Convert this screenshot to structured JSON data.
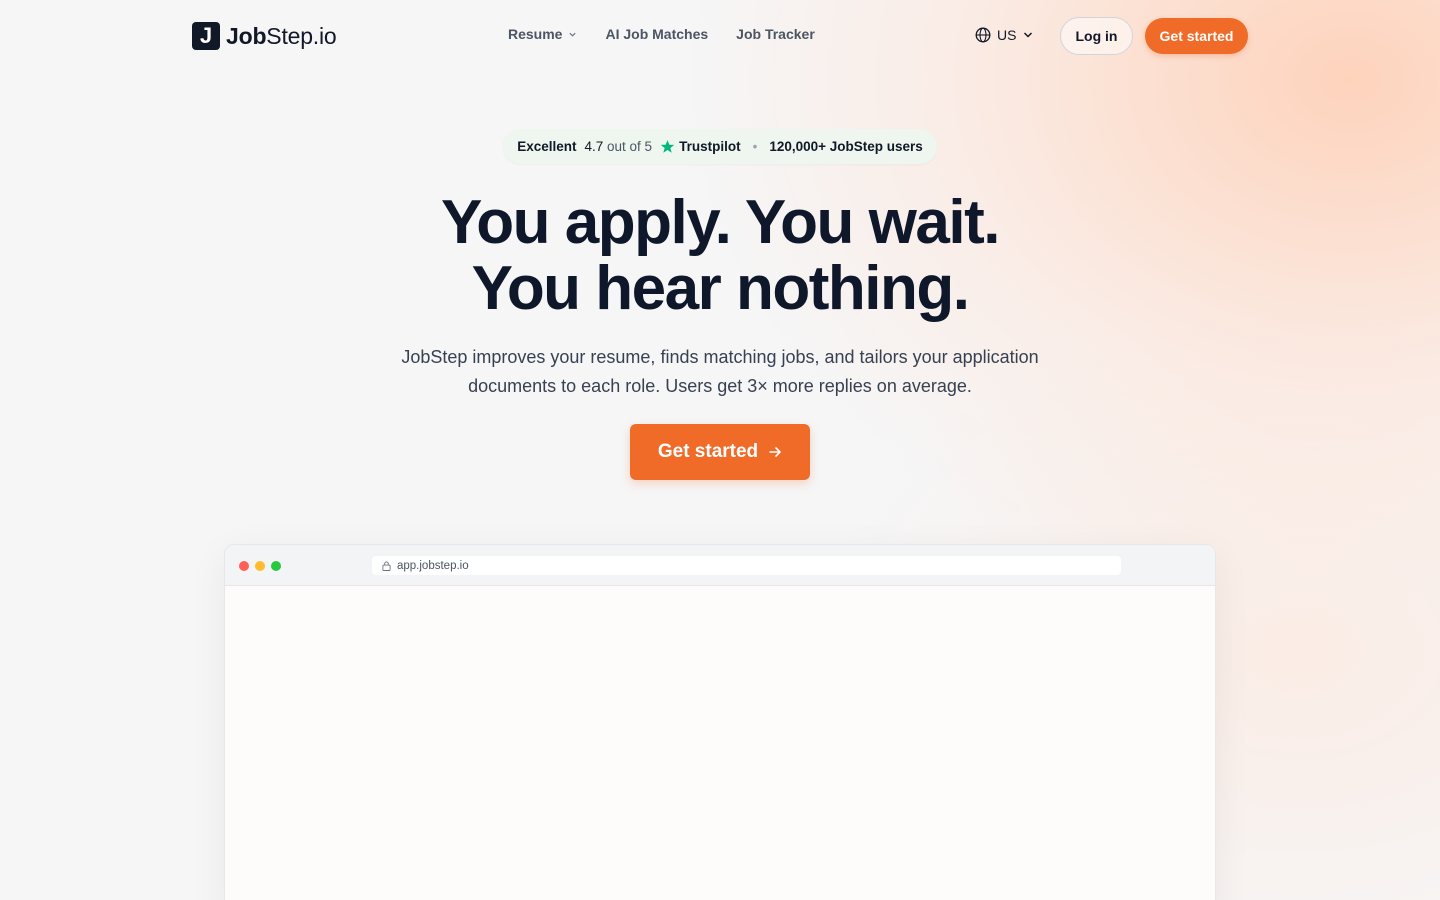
{
  "nav": {
    "logo_mark": "J",
    "logo_bold": "Job",
    "logo_rest": "Step.io",
    "links": [
      {
        "label": "Resume",
        "has_dropdown": true
      },
      {
        "label": "AI Job Matches",
        "has_dropdown": false
      },
      {
        "label": "Job Tracker",
        "has_dropdown": false
      }
    ],
    "locale": "US",
    "login_label": "Log in",
    "get_started_label": "Get started"
  },
  "badge": {
    "rating_word": "Excellent",
    "score": "4.7",
    "out_of": "out of 5",
    "platform": "Trustpilot",
    "users": "120,000+ JobStep users",
    "star_color": "#00b67a"
  },
  "hero": {
    "headline_line1": "You apply. You wait.",
    "headline_line2": "You hear nothing.",
    "subhead_line1": "JobStep improves your resume, finds matching jobs, and tailors your application",
    "subhead_line2": "documents to each role. Users get 3× more replies on average.",
    "cta_label": "Get started"
  },
  "browser": {
    "url": "app.jobstep.io"
  },
  "colors": {
    "accent": "#f06a28",
    "text": "#0f172a"
  }
}
